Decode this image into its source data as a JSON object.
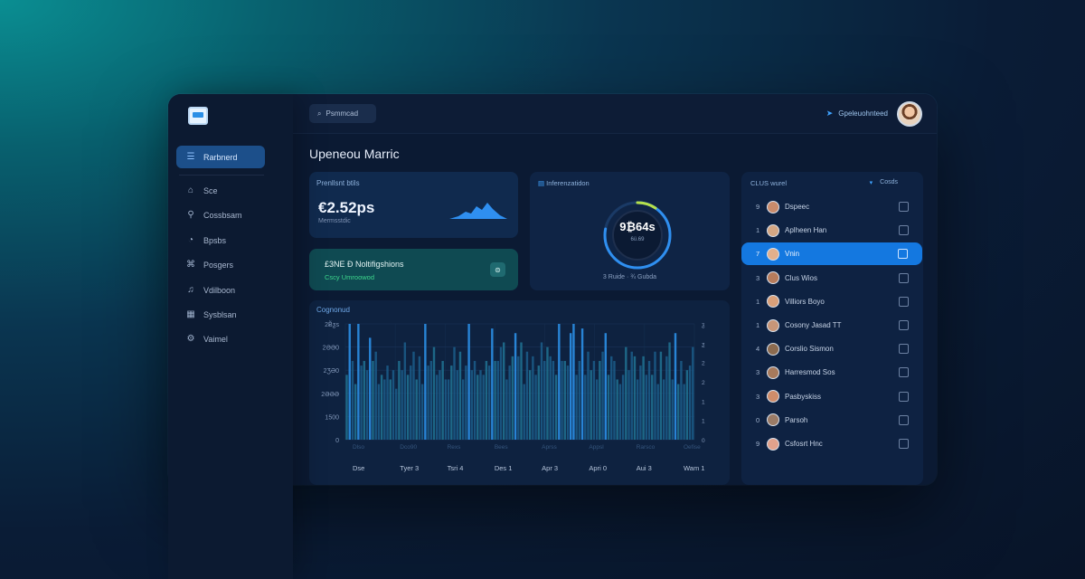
{
  "sidebar": {
    "items": [
      {
        "label": "Rarbnerd",
        "icon": "dashboard-icon",
        "glyph": "☰",
        "active": true
      },
      {
        "label": "Sce",
        "icon": "home-icon",
        "glyph": "⌂"
      },
      {
        "label": "Cossbsam",
        "icon": "users-icon",
        "glyph": "⚲"
      },
      {
        "label": "Bpsbs",
        "icon": "chart-icon",
        "glyph": "◔"
      },
      {
        "label": "Posgers",
        "icon": "projects-icon",
        "glyph": "⌘"
      },
      {
        "label": "Vdilboon",
        "icon": "bell-icon",
        "glyph": "♫"
      },
      {
        "label": "Sysblsan",
        "icon": "grid-icon",
        "glyph": "▦"
      },
      {
        "label": "Vaimel",
        "icon": "settings-icon",
        "glyph": "⚙"
      }
    ]
  },
  "topbar": {
    "search_label": "Psmmcad",
    "user_label": "Gpeleuohnteed"
  },
  "page": {
    "title": "Upeneou Marric"
  },
  "stat_card": {
    "label": "Prenllsnt btils",
    "value": "€2.52ps",
    "sub": "Mermsstdic"
  },
  "notif_card": {
    "title": "£3NE Ð Noltifigshions",
    "sub": "Cscy Umroowod",
    "button_glyph": "⊜"
  },
  "gauge_card": {
    "label": "Inferenzatidon",
    "value": "9₿64s",
    "sub": "6ϋ.69",
    "foot": "3 Ruide · ¾ Gubda",
    "progress": 0.78
  },
  "bar_chart": {
    "label": "Cognonud",
    "y_ticks_left": [
      "2Ƀ̃ƺs",
      "2ƏƏ0",
      "2ƷƏ0",
      "2ƏƏƏ",
      "1500",
      "0"
    ],
    "y_ticks_right": [
      "ƺ",
      "ƺ",
      "2",
      "2",
      "1",
      "1",
      "0"
    ],
    "x_labels": [
      "Dse",
      "Tyer 3",
      "Tsri 4",
      "Des 1",
      "Apr 3",
      "Apri 0",
      "Aui 3",
      "Wam 1"
    ],
    "x_sublabels": [
      "Dlso",
      "Dco90",
      "Rexs",
      "Bees",
      "Aprss",
      "Appsl",
      "Rarsco",
      "Oefise"
    ]
  },
  "chart_data": {
    "type": "bar",
    "ylim": [
      0,
      2500
    ],
    "values": [
      1400,
      2700,
      1700,
      1200,
      2800,
      1600,
      1700,
      1500,
      2200,
      1700,
      1900,
      1200,
      1400,
      1300,
      1600,
      1300,
      1500,
      1100,
      1700,
      1500,
      2100,
      1400,
      1600,
      1900,
      1300,
      1800,
      1200,
      2600,
      1600,
      1700,
      2000,
      1400,
      1500,
      1700,
      1300,
      1300,
      1600,
      2000,
      1500,
      1900,
      1300,
      1600,
      2700,
      1500,
      1700,
      1400,
      1500,
      1400,
      1700,
      1600,
      2400,
      1700,
      1700,
      2000,
      2100,
      1300,
      1600,
      1800,
      2300,
      1800,
      2100,
      1200,
      1900,
      1500,
      1800,
      1400,
      1600,
      2100,
      1700,
      2000,
      1800,
      1700,
      1400,
      2500,
      1700,
      1700,
      1600,
      2300,
      2500,
      1400,
      1700,
      2400,
      1400,
      1900,
      1500,
      1700,
      1300,
      1700,
      1900,
      2300,
      1400,
      1800,
      1700,
      1300,
      1200,
      1400,
      2000,
      1500,
      1900,
      1800,
      1300,
      1600,
      1800,
      1400,
      1700,
      1400,
      1900,
      1200,
      1900,
      1300,
      1800,
      2100,
      1300,
      2300,
      1200,
      1700,
      1200,
      1500,
      1600,
      2000
    ]
  },
  "list": {
    "header": "CLUS wurel",
    "header_right": "Cosds",
    "rows": [
      {
        "num": "9",
        "name": "Dspeec",
        "avatar": "#c98b6b"
      },
      {
        "num": "1",
        "name": "Aplheen Han",
        "avatar": "#d4a784"
      },
      {
        "num": "7",
        "name": "Vnin",
        "avatar": "#e3b08c",
        "active": true
      },
      {
        "num": "3",
        "name": "Clus Wios",
        "avatar": "#b77c5c"
      },
      {
        "num": "1",
        "name": "Villiors Boyo",
        "avatar": "#d9a07a"
      },
      {
        "num": "1",
        "name": "Cosony Jasad TT",
        "avatar": "#c89678"
      },
      {
        "num": "4",
        "name": "Corslio Sismon",
        "avatar": "#8c6b4f"
      },
      {
        "num": "3",
        "name": "Harresmod Sos",
        "avatar": "#a77a5c"
      },
      {
        "num": "3",
        "name": "Pasbyskiss",
        "avatar": "#d08d6a"
      },
      {
        "num": "0",
        "name": "Parsoh",
        "avatar": "#9a7b66"
      },
      {
        "num": "9",
        "name": "Csfosrt Hnc",
        "avatar": "#e2a28c"
      }
    ]
  },
  "colors": {
    "accent": "#1478e0",
    "bars": "#1f6fb5",
    "teal": "#0f4a52"
  }
}
